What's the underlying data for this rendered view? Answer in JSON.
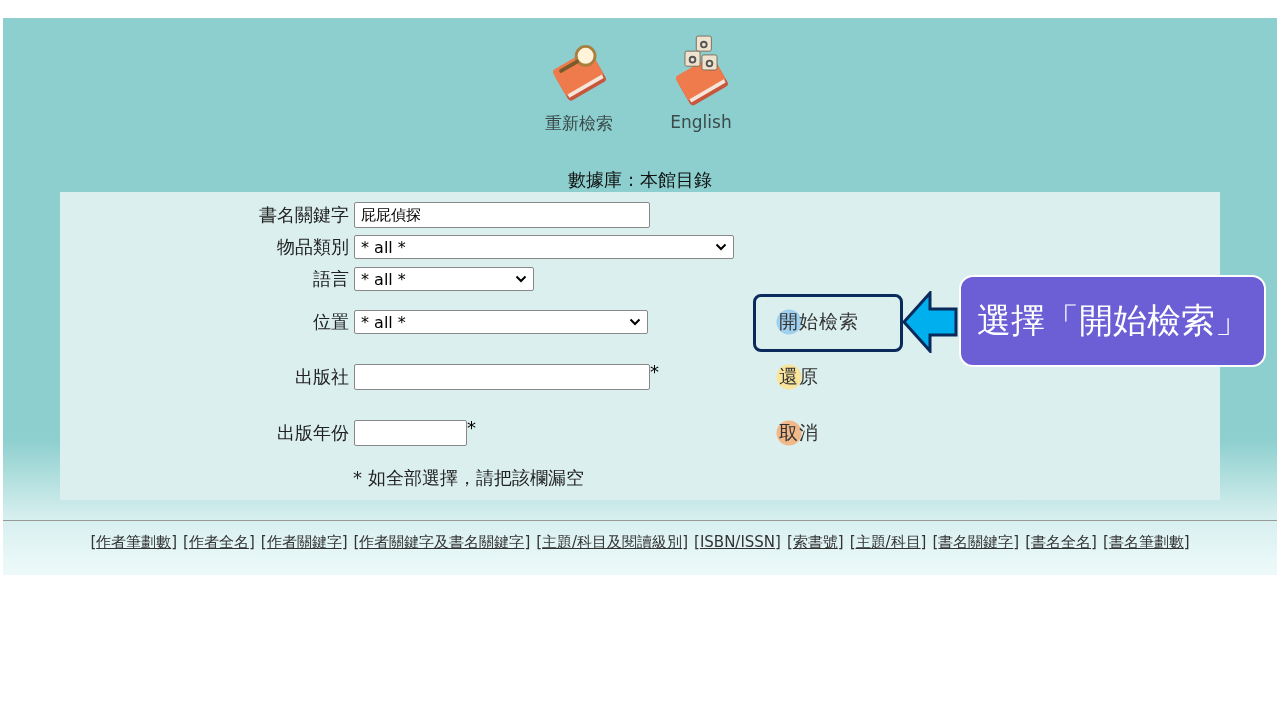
{
  "toolbar": [
    {
      "kind": "search",
      "label": "重新檢索"
    },
    {
      "kind": "english",
      "label": "English"
    }
  ],
  "database": "數據庫 : 本館目錄",
  "form": {
    "fields": [
      {
        "kind": "text",
        "label": "書名關鍵字",
        "value": "屁屁偵探"
      },
      {
        "kind": "select",
        "label": "物品類別",
        "value": "* all *"
      },
      {
        "kind": "select",
        "label": "語言",
        "value": "* all *"
      },
      {
        "kind": "select",
        "label": "位置",
        "value": "* all *"
      },
      {
        "kind": "text",
        "label": "出版社",
        "mark": "*"
      },
      {
        "kind": "text",
        "label": "出版年份",
        "mark": "*"
      }
    ],
    "note": "* 如全部選擇，請把該欄漏空",
    "buttons": [
      {
        "label": "開始檢索",
        "color": "#9fd0ef",
        "highlighted": true
      },
      {
        "label": "還原",
        "color": "#f8e49a",
        "highlighted": false
      },
      {
        "label": "取消",
        "color": "#f1b98a",
        "highlighted": false
      }
    ]
  },
  "annotation": {
    "text": "選擇「開始檢索」"
  },
  "footer_links": [
    {
      "open": "[",
      "label": "作者筆劃數",
      "close": "]"
    },
    {
      "open": "[",
      "label": "作者全名",
      "close": "]"
    },
    {
      "open": "[",
      "label": "作者關鍵字",
      "close": "]"
    },
    {
      "open": "[",
      "label": "作者關鍵字及書名關鍵字",
      "close": "]"
    },
    {
      "open": "[",
      "label": "主題/科目及閱讀級別",
      "close": "]"
    },
    {
      "open": "[",
      "label": "ISBN/ISSN",
      "close": "]"
    },
    {
      "open": "[",
      "label": "索書號",
      "close": "]"
    },
    {
      "open": "[",
      "label": "主題/科目",
      "close": "]"
    },
    {
      "open": "[",
      "label": "書名關鍵字",
      "close": "]"
    },
    {
      "open": "[",
      "label": "書名全名",
      "close": "]"
    },
    {
      "open": "[",
      "label": "書名筆劃數",
      "close": "]"
    }
  ]
}
